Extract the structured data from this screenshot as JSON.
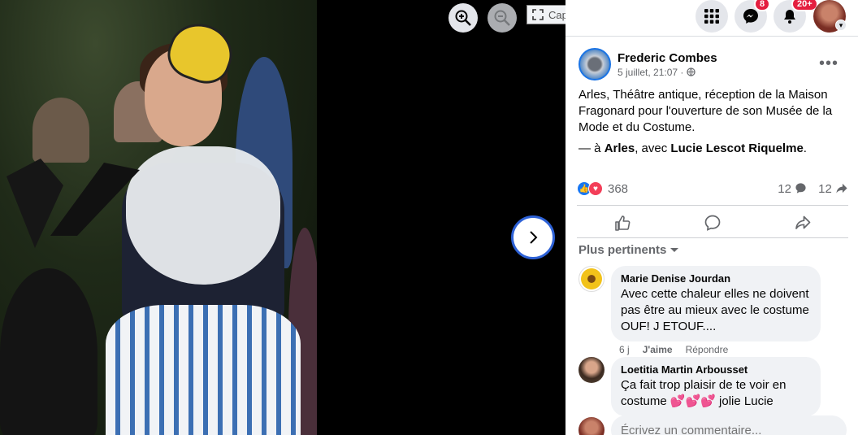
{
  "viewer": {
    "zoom_in_icon": "zoom-in-icon",
    "zoom_out_icon": "zoom-out-icon",
    "fullscreen_label": "Capture Plein écran",
    "next_icon": "chevron-right-icon"
  },
  "topbar": {
    "messenger_badge": "8",
    "notifications_badge": "20+"
  },
  "post": {
    "author": "Frederic Combes",
    "date": "5 juillet, 21:07 ·",
    "text": "Arles, Théâtre antique, réception de la Maison Fragonard pour l'ouverture de son Musée de la Mode et du Costume.",
    "tag_prefix": "— à ",
    "tag_place": "Arles",
    "tag_with": ", avec ",
    "tag_person": "Lucie Lescot Riquelme",
    "tag_suffix": ".",
    "reaction_count": "368",
    "comment_count": "12",
    "share_count": "12"
  },
  "sort_label": "Plus pertinents",
  "comments": [
    {
      "name": "Marie Denise Jourdan",
      "text": "Avec cette chaleur elles ne doivent pas être au mieux avec le costume OUF! J ETOUF....",
      "time": "6 j",
      "like": "J'aime",
      "reply": "Répondre"
    },
    {
      "name": "Loetitia Martin Arbousset",
      "text": "Ça fait trop plaisir de te voir en costume 💕💕💕 jolie Lucie"
    }
  ],
  "composer": {
    "placeholder": "Écrivez un commentaire..."
  },
  "colors": {
    "accent": "#1877f2",
    "love": "#f33e58",
    "badge": "#e41e3f"
  }
}
